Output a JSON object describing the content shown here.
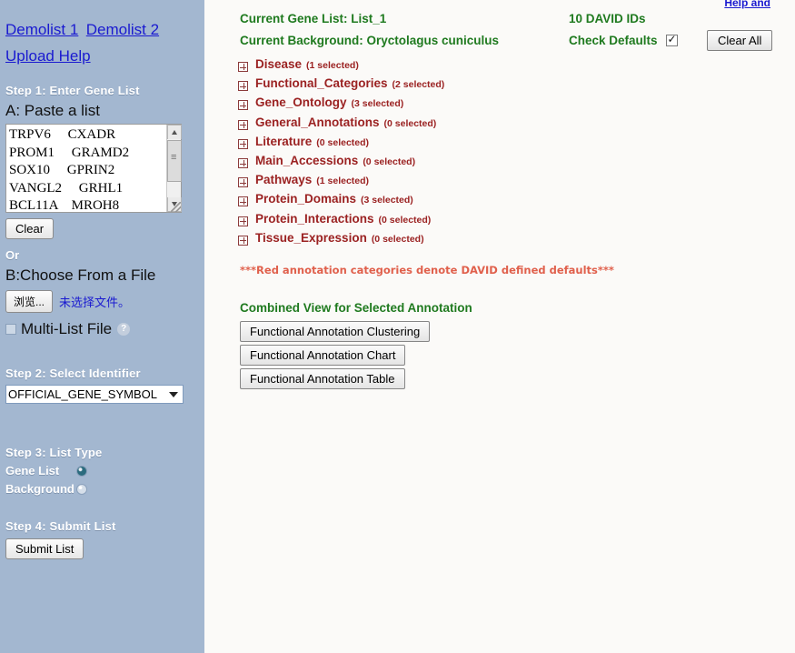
{
  "sidebar": {
    "links": [
      {
        "label": "Demolist 1",
        "name": "demolist-1-link"
      },
      {
        "label": "Demolist 2",
        "name": "demolist-2-link"
      }
    ],
    "upload_help_link": "Upload Help",
    "step1_title": "Step 1: Enter Gene List",
    "paste_label": "A: Paste a list",
    "gene_textarea_value": "TRPV6     CXADR\nPROM1     GRAMD2\nSOX10     GPRIN2\nVANGL2     GRHL1\nBCL11A    MROH8",
    "clear_button": "Clear",
    "or_label": "Or",
    "choose_file_label": "B:Choose From a File",
    "browse_button": "浏览...",
    "no_file_text": "未选择文件。",
    "multilist_label": "Multi-List File",
    "help_icon_label": "?",
    "step2_title": "Step 2: Select Identifier",
    "identifier_selected": "OFFICIAL_GENE_SYMBOL",
    "step3_title": "Step 3: List Type",
    "gene_list_label": "Gene List",
    "background_label": "Background",
    "step4_title": "Step 4: Submit List",
    "submit_button": "Submit List"
  },
  "main": {
    "help_and_link": "Help and",
    "current_gene_list": "Current Gene List: List_1",
    "current_background": "Current Background: Oryctolagus cuniculus",
    "david_ids": "10 DAVID IDs",
    "check_defaults_label": "Check Defaults",
    "clear_all_button": "Clear All",
    "categories": [
      {
        "name": "Disease",
        "count": "(1 selected)"
      },
      {
        "name": "Functional_Categories",
        "count": "(2 selected)"
      },
      {
        "name": "Gene_Ontology",
        "count": "(3 selected)"
      },
      {
        "name": "General_Annotations",
        "count": "(0 selected)"
      },
      {
        "name": "Literature",
        "count": "(0 selected)"
      },
      {
        "name": "Main_Accessions",
        "count": "(0 selected)"
      },
      {
        "name": "Pathways",
        "count": "(1 selected)"
      },
      {
        "name": "Protein_Domains",
        "count": "(3 selected)"
      },
      {
        "name": "Protein_Interactions",
        "count": "(0 selected)"
      },
      {
        "name": "Tissue_Expression",
        "count": "(0 selected)"
      }
    ],
    "red_note": "***Red annotation categories denote DAVID defined defaults***",
    "combined_view_title": "Combined View for Selected Annotation",
    "buttons": {
      "clustering": "Functional Annotation Clustering",
      "chart": "Functional Annotation Chart",
      "table": "Functional Annotation Table"
    }
  },
  "colors": {
    "sidebar_bg": "#a3b7d0",
    "main_bg": "#fbfaf8",
    "green_text": "#1f7a1f",
    "red_category": "#9b2222",
    "red_note": "#e0604c",
    "link_blue": "#1a1ad0"
  }
}
